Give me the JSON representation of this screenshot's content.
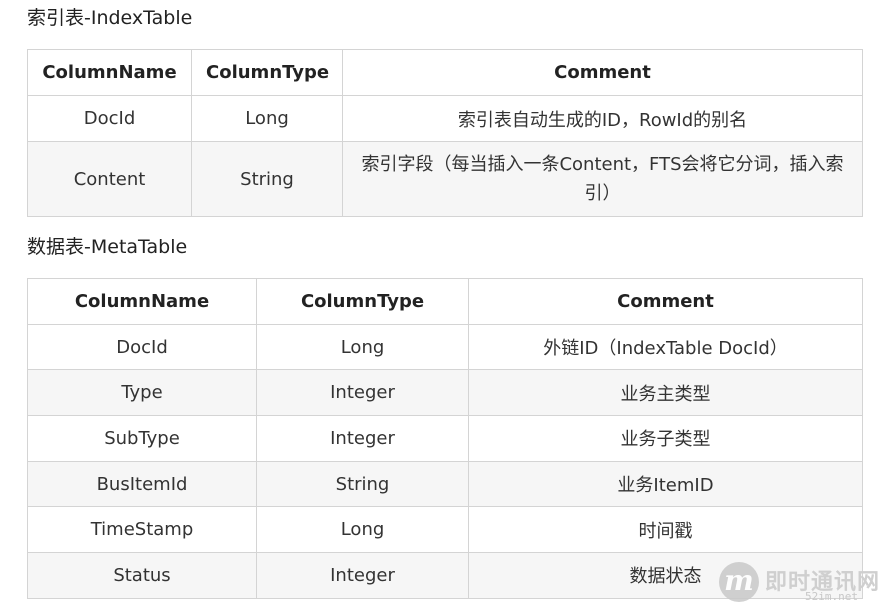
{
  "index_section": {
    "title": "索引表-IndexTable",
    "headers": [
      "ColumnName",
      "ColumnType",
      "Comment"
    ],
    "rows": [
      [
        "DocId",
        "Long",
        "索引表自动生成的ID，RowId的别名"
      ],
      [
        "Content",
        "String",
        "索引字段（每当插入一条Content，FTS会将它分词，插入索引）"
      ]
    ]
  },
  "meta_section": {
    "title": "数据表-MetaTable",
    "headers": [
      "ColumnName",
      "ColumnType",
      "Comment"
    ],
    "rows": [
      [
        "DocId",
        "Long",
        "外链ID（IndexTable DocId）"
      ],
      [
        "Type",
        "Integer",
        "业务主类型"
      ],
      [
        "SubType",
        "Integer",
        "业务子类型"
      ],
      [
        "BusItemId",
        "String",
        "业务ItemID"
      ],
      [
        "TimeStamp",
        "Long",
        "时间戳"
      ],
      [
        "Status",
        "Integer",
        "数据状态"
      ]
    ]
  },
  "watermark": {
    "logo_letter": "m",
    "site_name": "即时通讯网",
    "url": "52im.net"
  }
}
